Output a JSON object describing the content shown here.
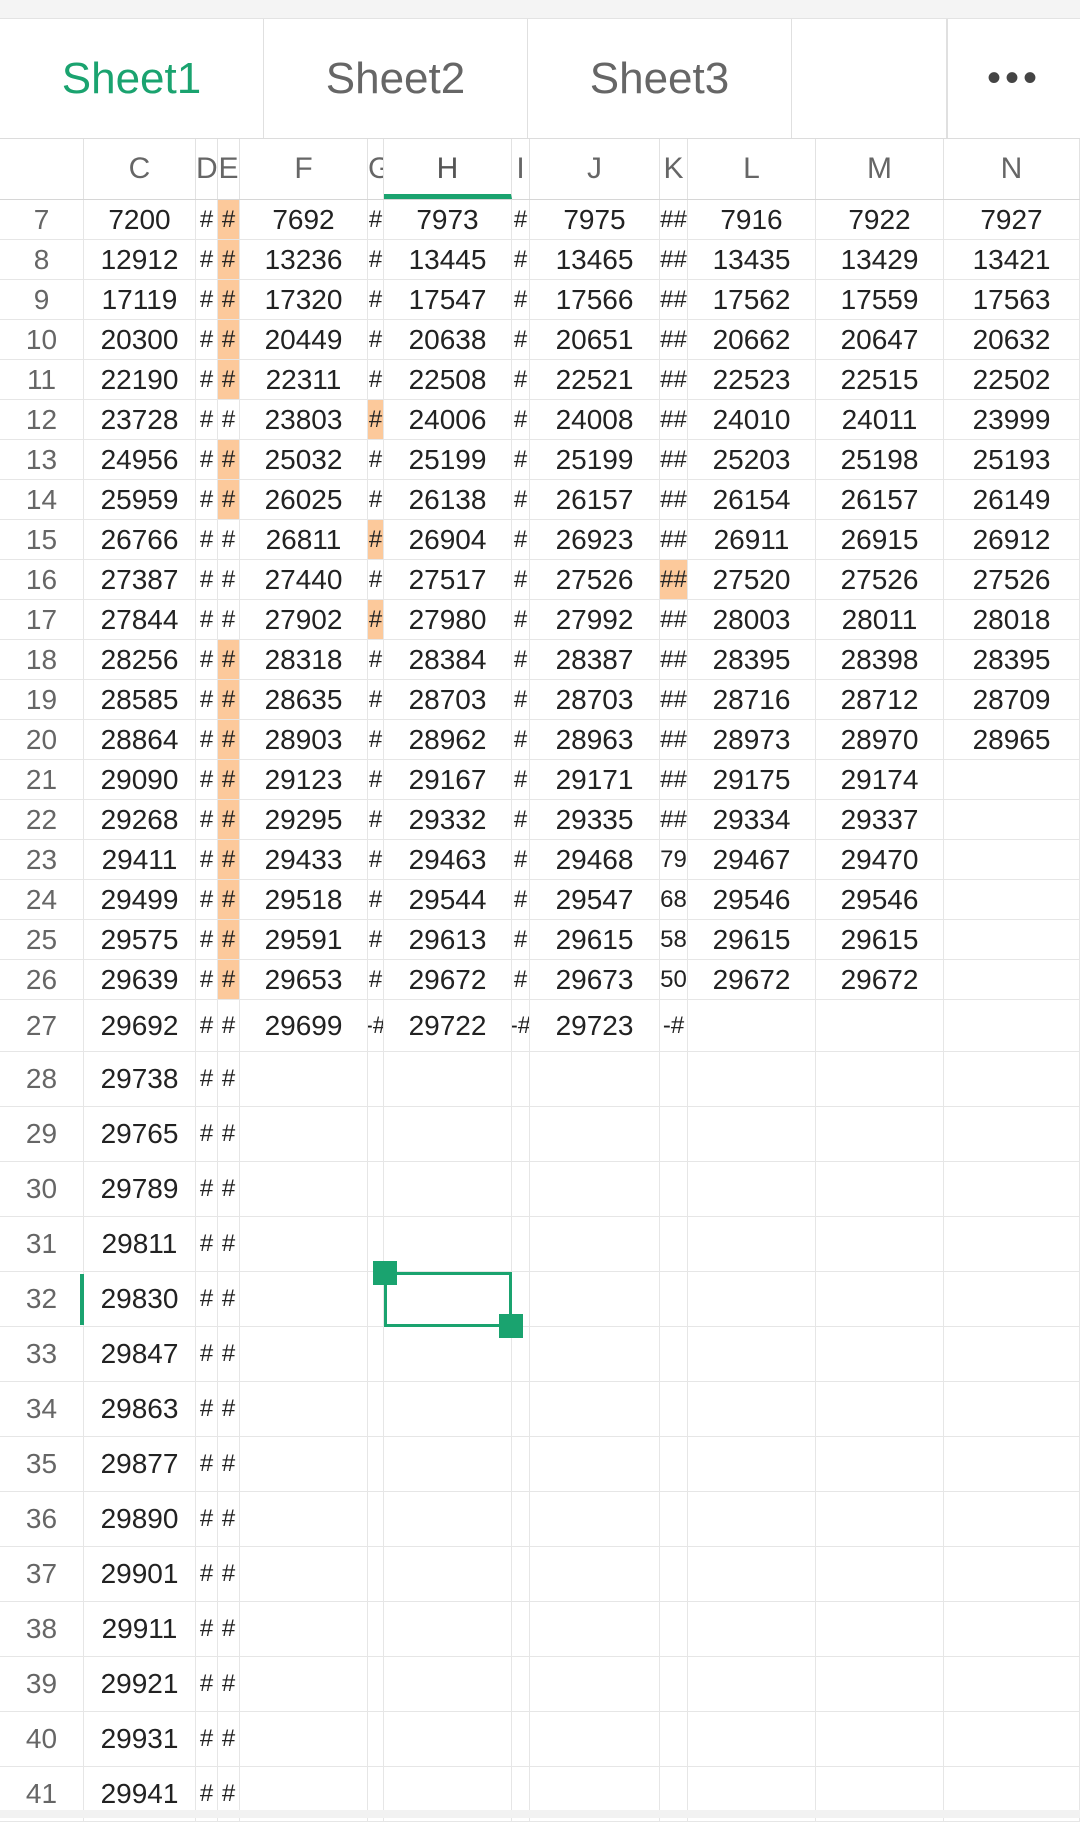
{
  "tabs": [
    {
      "label": "Sheet1",
      "active": true
    },
    {
      "label": "Sheet2",
      "active": false
    },
    {
      "label": "Sheet3",
      "active": false
    }
  ],
  "more_label": "•••",
  "accent_color": "#1aa36f",
  "highlight_color": "#fcc99b",
  "columns": [
    {
      "label": "C",
      "selected": false
    },
    {
      "label": "D",
      "selected": false
    },
    {
      "label": "E",
      "selected": false
    },
    {
      "label": "F",
      "selected": false
    },
    {
      "label": "G",
      "selected": false
    },
    {
      "label": "H",
      "selected": true
    },
    {
      "label": "I",
      "selected": false
    },
    {
      "label": "J",
      "selected": false
    },
    {
      "label": "K",
      "selected": false
    },
    {
      "label": "L",
      "selected": false
    },
    {
      "label": "M",
      "selected": false
    },
    {
      "label": "N",
      "selected": false
    }
  ],
  "selected_cell": "H32",
  "rows": [
    {
      "n": "7",
      "cells": [
        "7200",
        "#",
        "#",
        "7692",
        "#",
        "7973",
        "#",
        "7975",
        "##",
        "7916",
        "7922",
        "7927"
      ],
      "hl": [
        2
      ]
    },
    {
      "n": "8",
      "cells": [
        "12912",
        "#",
        "#",
        "13236",
        "#",
        "13445",
        "#",
        "13465",
        "##",
        "13435",
        "13429",
        "13421"
      ],
      "hl": [
        2
      ]
    },
    {
      "n": "9",
      "cells": [
        "17119",
        "#",
        "#",
        "17320",
        "#",
        "17547",
        "#",
        "17566",
        "##",
        "17562",
        "17559",
        "17563"
      ],
      "hl": [
        2
      ]
    },
    {
      "n": "10",
      "cells": [
        "20300",
        "#",
        "#",
        "20449",
        "#",
        "20638",
        "#",
        "20651",
        "##",
        "20662",
        "20647",
        "20632"
      ],
      "hl": [
        2
      ]
    },
    {
      "n": "11",
      "cells": [
        "22190",
        "#",
        "#",
        "22311",
        "#",
        "22508",
        "#",
        "22521",
        "##",
        "22523",
        "22515",
        "22502"
      ],
      "hl": [
        2
      ]
    },
    {
      "n": "12",
      "cells": [
        "23728",
        "#",
        "#",
        "23803",
        "#",
        "24006",
        "#",
        "24008",
        "##",
        "24010",
        "24011",
        "23999"
      ],
      "hl": [
        4
      ]
    },
    {
      "n": "13",
      "cells": [
        "24956",
        "#",
        "#",
        "25032",
        "#",
        "25199",
        "#",
        "25199",
        "##",
        "25203",
        "25198",
        "25193"
      ],
      "hl": [
        2
      ]
    },
    {
      "n": "14",
      "cells": [
        "25959",
        "#",
        "#",
        "26025",
        "#",
        "26138",
        "#",
        "26157",
        "##",
        "26154",
        "26157",
        "26149"
      ],
      "hl": [
        2
      ]
    },
    {
      "n": "15",
      "cells": [
        "26766",
        "#",
        "#",
        "26811",
        "#",
        "26904",
        "#",
        "26923",
        "##",
        "26911",
        "26915",
        "26912"
      ],
      "hl": [
        4
      ]
    },
    {
      "n": "16",
      "cells": [
        "27387",
        "#",
        "#",
        "27440",
        "#",
        "27517",
        "#",
        "27526",
        "##",
        "27520",
        "27526",
        "27526"
      ],
      "hl": [
        8
      ]
    },
    {
      "n": "17",
      "cells": [
        "27844",
        "#",
        "#",
        "27902",
        "#",
        "27980",
        "#",
        "27992",
        "##",
        "28003",
        "28011",
        "28018"
      ],
      "hl": [
        4
      ]
    },
    {
      "n": "18",
      "cells": [
        "28256",
        "#",
        "#",
        "28318",
        "#",
        "28384",
        "#",
        "28387",
        "##",
        "28395",
        "28398",
        "28395"
      ],
      "hl": [
        2
      ]
    },
    {
      "n": "19",
      "cells": [
        "28585",
        "#",
        "#",
        "28635",
        "#",
        "28703",
        "#",
        "28703",
        "##",
        "28716",
        "28712",
        "28709"
      ],
      "hl": [
        2
      ]
    },
    {
      "n": "20",
      "cells": [
        "28864",
        "#",
        "#",
        "28903",
        "#",
        "28962",
        "#",
        "28963",
        "##",
        "28973",
        "28970",
        "28965"
      ],
      "hl": [
        2
      ]
    },
    {
      "n": "21",
      "cells": [
        "29090",
        "#",
        "#",
        "29123",
        "#",
        "29167",
        "#",
        "29171",
        "##",
        "29175",
        "29174",
        ""
      ],
      "hl": [
        2
      ]
    },
    {
      "n": "22",
      "cells": [
        "29268",
        "#",
        "#",
        "29295",
        "#",
        "29332",
        "#",
        "29335",
        "##",
        "29334",
        "29337",
        ""
      ],
      "hl": [
        2
      ]
    },
    {
      "n": "23",
      "cells": [
        "29411",
        "#",
        "#",
        "29433",
        "#",
        "29463",
        "#",
        "29468",
        "79",
        "29467",
        "29470",
        ""
      ],
      "hl": [
        2
      ]
    },
    {
      "n": "24",
      "cells": [
        "29499",
        "#",
        "#",
        "29518",
        "#",
        "29544",
        "#",
        "29547",
        "68",
        "29546",
        "29546",
        ""
      ],
      "hl": [
        2
      ]
    },
    {
      "n": "25",
      "cells": [
        "29575",
        "#",
        "#",
        "29591",
        "#",
        "29613",
        "#",
        "29615",
        "58",
        "29615",
        "29615",
        ""
      ],
      "hl": [
        2
      ]
    },
    {
      "n": "26",
      "cells": [
        "29639",
        "#",
        "#",
        "29653",
        "#",
        "29672",
        "#",
        "29673",
        "50",
        "29672",
        "29672",
        ""
      ],
      "hl": [
        2
      ]
    },
    {
      "n": "27",
      "cells": [
        "29692",
        "#",
        "#",
        "29699",
        "-#",
        "29722",
        "-#",
        "29723",
        "-#",
        "",
        "",
        ""
      ],
      "hl": []
    },
    {
      "n": "28",
      "cells": [
        "29738",
        "#",
        "#",
        "",
        "",
        "",
        "",
        "",
        "",
        "",
        "",
        ""
      ],
      "hl": []
    },
    {
      "n": "29",
      "cells": [
        "29765",
        "#",
        "#",
        "",
        "",
        "",
        "",
        "",
        "",
        "",
        "",
        ""
      ],
      "hl": []
    },
    {
      "n": "30",
      "cells": [
        "29789",
        "#",
        "#",
        "",
        "",
        "",
        "",
        "",
        "",
        "",
        "",
        ""
      ],
      "hl": []
    },
    {
      "n": "31",
      "cells": [
        "29811",
        "#",
        "#",
        "",
        "",
        "",
        "",
        "",
        "",
        "",
        "",
        ""
      ],
      "hl": []
    },
    {
      "n": "32",
      "cells": [
        "29830",
        "#",
        "#",
        "",
        "",
        "",
        "",
        "",
        "",
        "",
        "",
        ""
      ],
      "hl": []
    },
    {
      "n": "33",
      "cells": [
        "29847",
        "#",
        "#",
        "",
        "",
        "",
        "",
        "",
        "",
        "",
        "",
        ""
      ],
      "hl": []
    },
    {
      "n": "34",
      "cells": [
        "29863",
        "#",
        "#",
        "",
        "",
        "",
        "",
        "",
        "",
        "",
        "",
        ""
      ],
      "hl": []
    },
    {
      "n": "35",
      "cells": [
        "29877",
        "#",
        "#",
        "",
        "",
        "",
        "",
        "",
        "",
        "",
        "",
        ""
      ],
      "hl": []
    },
    {
      "n": "36",
      "cells": [
        "29890",
        "#",
        "#",
        "",
        "",
        "",
        "",
        "",
        "",
        "",
        "",
        ""
      ],
      "hl": []
    },
    {
      "n": "37",
      "cells": [
        "29901",
        "#",
        "#",
        "",
        "",
        "",
        "",
        "",
        "",
        "",
        "",
        ""
      ],
      "hl": []
    },
    {
      "n": "38",
      "cells": [
        "29911",
        "#",
        "#",
        "",
        "",
        "",
        "",
        "",
        "",
        "",
        "",
        ""
      ],
      "hl": []
    },
    {
      "n": "39",
      "cells": [
        "29921",
        "#",
        "#",
        "",
        "",
        "",
        "",
        "",
        "",
        "",
        "",
        ""
      ],
      "hl": []
    },
    {
      "n": "40",
      "cells": [
        "29931",
        "#",
        "#",
        "",
        "",
        "",
        "",
        "",
        "",
        "",
        "",
        ""
      ],
      "hl": []
    },
    {
      "n": "41",
      "cells": [
        "29941",
        "#",
        "#",
        "",
        "",
        "",
        "",
        "",
        "",
        "",
        "",
        ""
      ],
      "hl": []
    }
  ]
}
